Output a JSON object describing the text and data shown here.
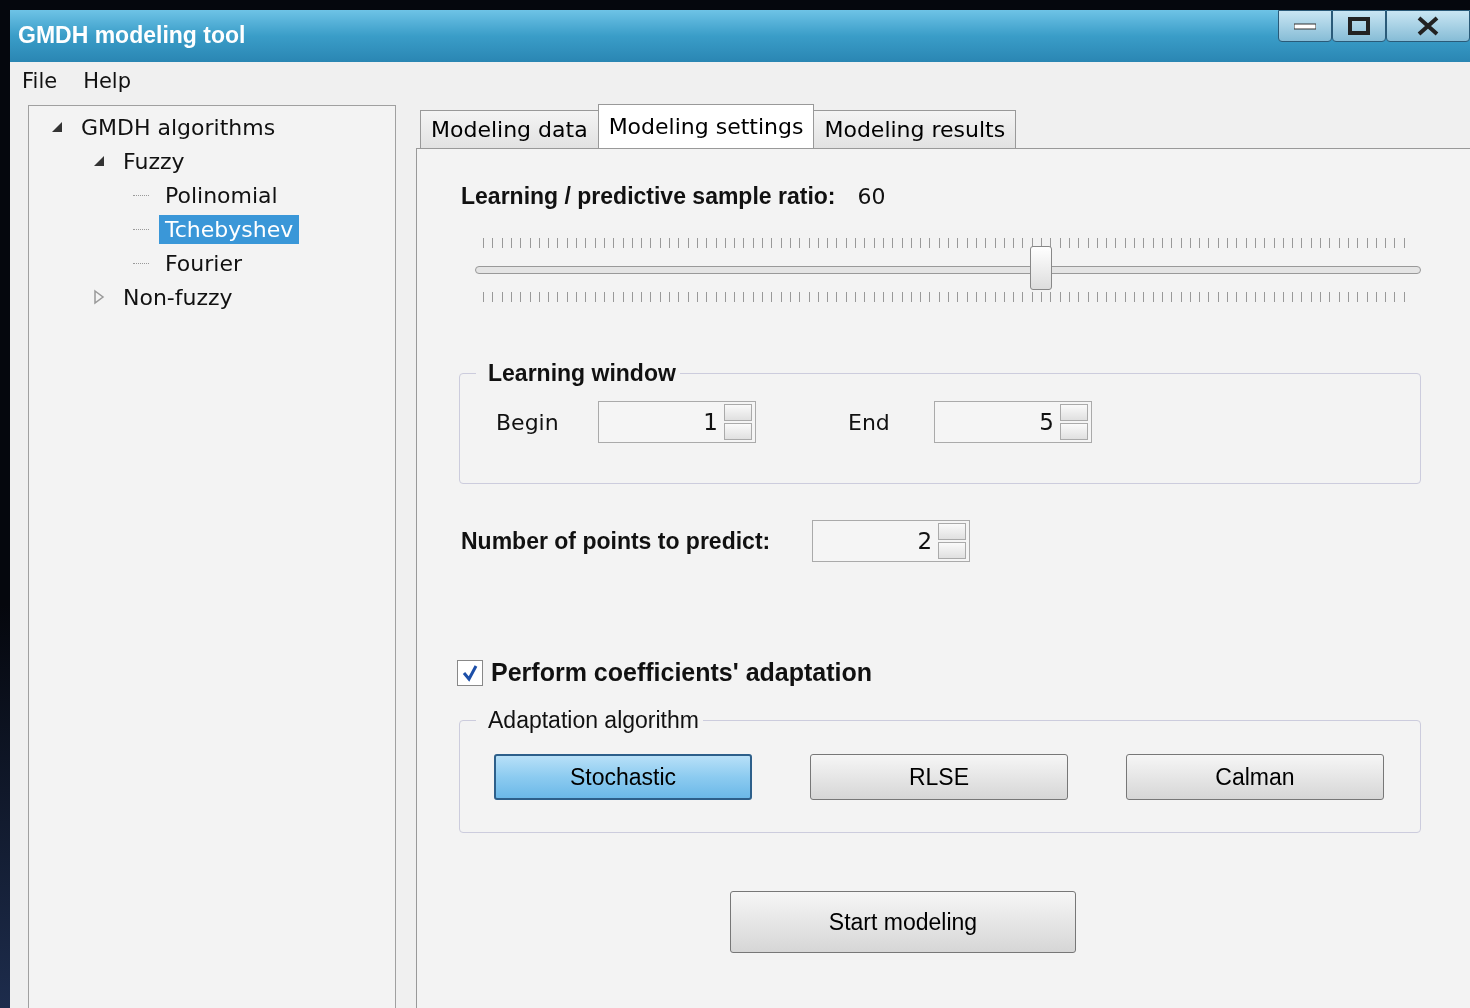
{
  "window": {
    "title": "GMDH modeling tool"
  },
  "menu": [
    "File",
    "Help"
  ],
  "tree": [
    {
      "label": "GMDH algorithms",
      "expanded": true,
      "selected": false,
      "children": [
        {
          "label": "Fuzzy",
          "expanded": true,
          "selected": false,
          "children": [
            {
              "label": "Polinomial",
              "selected": false
            },
            {
              "label": "Tchebyshev",
              "selected": true
            },
            {
              "label": "Fourier",
              "selected": false
            }
          ]
        },
        {
          "label": "Non-fuzzy",
          "expanded": false,
          "selected": false
        }
      ]
    }
  ],
  "tabs": [
    {
      "label": "Modeling data",
      "selected": false
    },
    {
      "label": "Modeling settings",
      "selected": true
    },
    {
      "label": "Modeling results",
      "selected": false
    }
  ],
  "ratio": {
    "label": "Learning / predictive sample ratio:",
    "value": "60",
    "level": 0.6
  },
  "learning_window": {
    "title": "Learning window",
    "begin": {
      "label": "Begin",
      "value": "1"
    },
    "end": {
      "label": "End",
      "value": "5"
    }
  },
  "points": {
    "label": "Number of points to predict:",
    "value": "2"
  },
  "adaptation": {
    "label": "Perform coefficients' adaptation",
    "checked": true
  },
  "algorithm": {
    "title": "Adaptation algorithm",
    "options": [
      {
        "label": "Stochastic",
        "selected": true
      },
      {
        "label": "RLSE",
        "selected": false
      },
      {
        "label": "Calman",
        "selected": false
      }
    ]
  },
  "start_button": "Start modeling"
}
